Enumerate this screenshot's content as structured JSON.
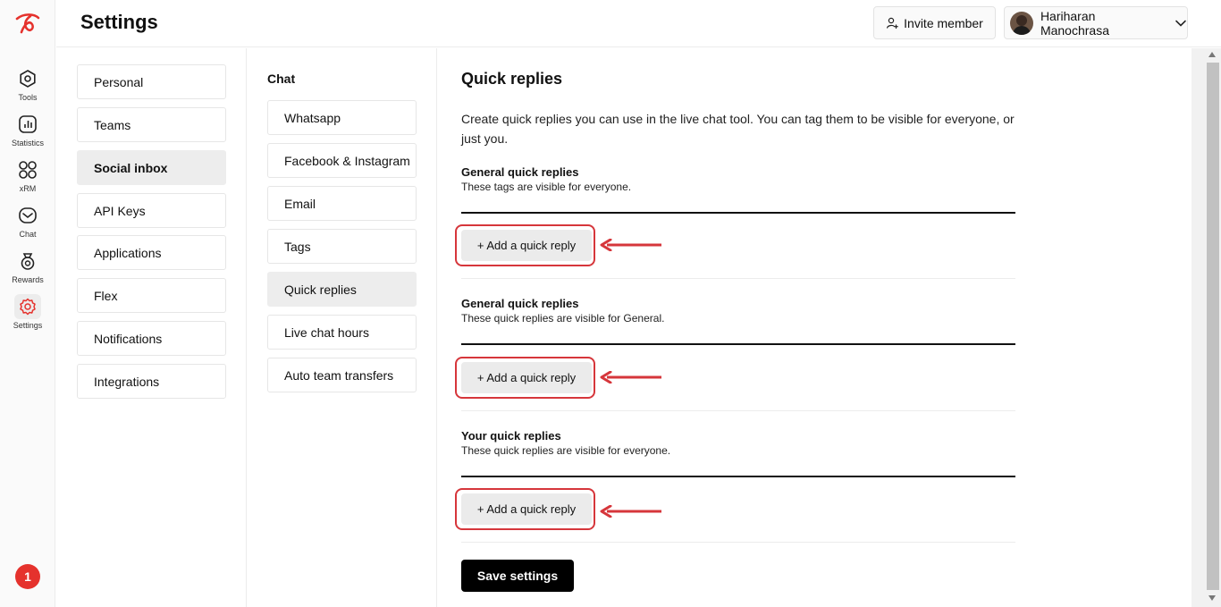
{
  "header": {
    "title": "Settings",
    "invite_label": "Invite member",
    "user_name": "Hariharan Manochrasa"
  },
  "rail": {
    "items": [
      {
        "label": "Tools",
        "icon": "tools-icon"
      },
      {
        "label": "Statistics",
        "icon": "statistics-icon"
      },
      {
        "label": "xRM",
        "icon": "grid-icon"
      },
      {
        "label": "Chat",
        "icon": "chat-icon"
      },
      {
        "label": "Rewards",
        "icon": "rewards-icon"
      },
      {
        "label": "Settings",
        "icon": "gear-icon"
      }
    ],
    "notification_count": "1"
  },
  "settings_nav": {
    "items": [
      {
        "label": "Personal"
      },
      {
        "label": "Teams"
      },
      {
        "label": "Social inbox"
      },
      {
        "label": "API Keys"
      },
      {
        "label": "Applications"
      },
      {
        "label": "Flex"
      },
      {
        "label": "Notifications"
      },
      {
        "label": "Integrations"
      }
    ],
    "active": "Social inbox"
  },
  "chat_nav": {
    "title": "Chat",
    "items": [
      {
        "label": "Whatsapp"
      },
      {
        "label": "Facebook & Instagram"
      },
      {
        "label": "Email"
      },
      {
        "label": "Tags"
      },
      {
        "label": "Quick replies"
      },
      {
        "label": "Live chat hours"
      },
      {
        "label": "Auto team transfers"
      }
    ],
    "active": "Quick replies"
  },
  "main": {
    "title": "Quick replies",
    "description": "Create quick replies you can use in the live chat tool. You can tag them to be visible for everyone, or just you.",
    "sections": [
      {
        "title": "General quick replies",
        "subtitle": "These tags are visible for everyone.",
        "button": "+ Add a quick reply"
      },
      {
        "title": "General quick replies",
        "subtitle": "These quick replies are visible for General.",
        "button": "+ Add a quick reply"
      },
      {
        "title": "Your quick replies",
        "subtitle": "These quick replies are visible for everyone.",
        "button": "+ Add a quick reply"
      }
    ],
    "save_label": "Save settings"
  },
  "colors": {
    "accent": "#e5322d",
    "annotation": "#d6363b",
    "primary_button": "#000000",
    "active_item": "#ededed"
  }
}
